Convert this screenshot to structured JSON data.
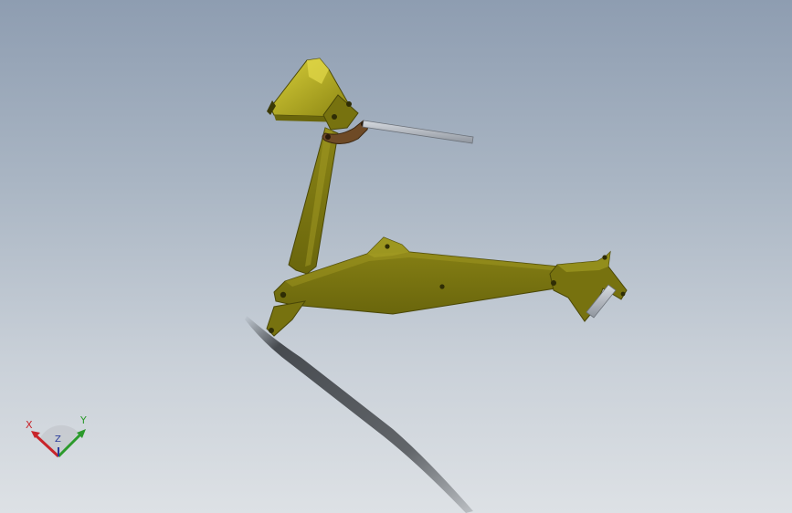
{
  "viewport": {
    "colors": {
      "background_top": "#8e9db1",
      "background_bottom": "#dde1e5",
      "part_body": "#77720f",
      "part_body_dark": "#5c5809",
      "part_highlight": "#a39c23",
      "bucket_face": "#c9bf2a",
      "link_brown": "#6e4a26",
      "cylinder_rod": "#a8aeb8",
      "shadow": "#1f2226"
    }
  },
  "triad": {
    "x_label": "X",
    "y_label": "Y",
    "z_label": "Z",
    "x_color": "#c8242a",
    "y_color": "#2c9a2c",
    "z_color": "#2a3b9a"
  }
}
